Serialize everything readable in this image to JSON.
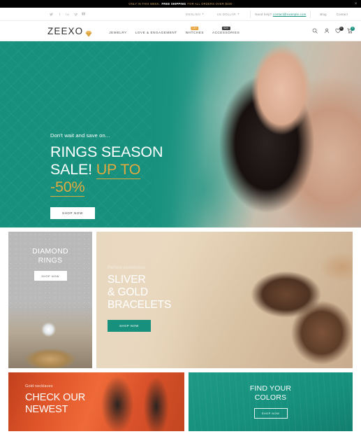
{
  "announcement": {
    "lead": "ONLY IN THIS WEEK.",
    "highlight": "FREE SHIPPING",
    "tail": "FOR ALL ORDERS OVER $400",
    "close_icon": "close-icon"
  },
  "utility": {
    "social": [
      {
        "name": "twitter-icon",
        "glyph": "ᴠ"
      },
      {
        "name": "facebook-icon",
        "glyph": "f"
      },
      {
        "name": "linkedin-icon",
        "glyph": "in"
      },
      {
        "name": "vimeo-icon",
        "glyph": "v"
      },
      {
        "name": "youtube-icon",
        "glyph": "▶"
      }
    ],
    "language": "ENGLISH",
    "currency": "US DOLLAR",
    "help_label": "Need help?",
    "help_email": "contact@example.com",
    "blog": "Blog",
    "contact": "Contact"
  },
  "header": {
    "logo_text": "ZEEXO",
    "logo_icon": "diamond-icon",
    "nav": [
      {
        "label": "JEWELRY",
        "badge": null
      },
      {
        "label": "LOVE & ENGAGEMENT",
        "badge": null
      },
      {
        "label": "WATCHES",
        "badge": "HOT",
        "badge_type": "hot"
      },
      {
        "label": "ACCESSORIES",
        "badge": "NEW",
        "badge_type": "new"
      }
    ],
    "icons": {
      "search": "search-icon",
      "account": "user-icon",
      "wishlist": "heart-icon",
      "cart": "cart-icon"
    },
    "wishlist_count": "0",
    "cart_count": "0"
  },
  "hero": {
    "kicker": "Don't wait and save on...",
    "line1": "RINGS SEASON",
    "line2": "SALE!",
    "gold1": "UP TO",
    "gold2": "-50%",
    "cta": "SHOP NOW"
  },
  "promos": {
    "rings": {
      "line1": "DIAMOND",
      "line2": "RINGS",
      "cta": "SHOP NOW"
    },
    "bracelets": {
      "kicker": "Perfect connection",
      "line1": "SLIVER",
      "line2": "& GOLD",
      "line3": "BRACELETS",
      "cta": "SHOP NOW"
    },
    "necklaces": {
      "kicker": "Gold necklaces",
      "line1": "CHECK OUR",
      "line2": "NEWEST"
    },
    "colors": {
      "line1": "FIND YOUR",
      "line2": "COLORS",
      "cta": "SHOP NOW"
    }
  },
  "colors": {
    "teal": "#17917E",
    "gold": "#E0A93F",
    "orange": "#D9532A",
    "dark": "#000000"
  }
}
